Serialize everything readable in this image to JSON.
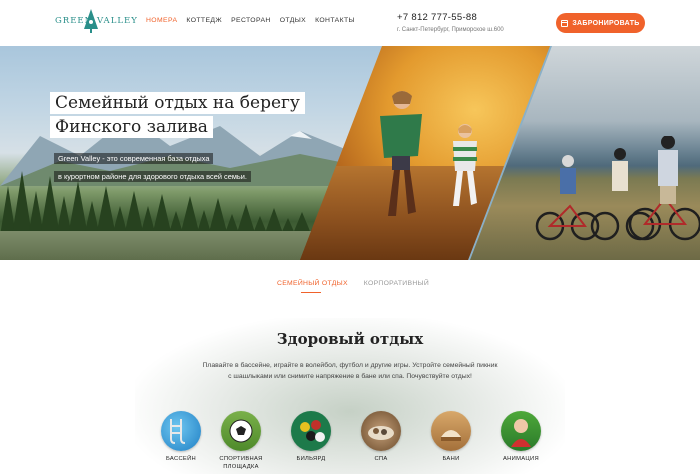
{
  "header": {
    "logo": {
      "word1": "GREEN",
      "word2": "VALLEY",
      "accent": "#2a8f8a"
    },
    "nav": [
      {
        "label": "НОМЕРА",
        "active": true
      },
      {
        "label": "КОТТЕДЖ",
        "active": false
      },
      {
        "label": "РЕСТОРАН",
        "active": false
      },
      {
        "label": "ОТДЫХ",
        "active": false
      },
      {
        "label": "КОНТАКТЫ",
        "active": false
      }
    ],
    "phone": "+7 812 777-55-88",
    "address": "г. Санкт-Петербург, Приморское ш.600",
    "book_button": {
      "label": "ЗАБРОНИРОВАТЬ",
      "icon": "calendar-icon",
      "color": "#f0622b"
    }
  },
  "hero": {
    "title_lines": [
      "Семейный отдых на  берегу",
      "Финского залива"
    ],
    "subtitle_lines": [
      "Green Valley - это современная база отдыха",
      "в курортном районе для здорового отдыха всей семьи."
    ]
  },
  "tabs": [
    {
      "label": "СЕМЕЙНЫЙ ОТДЫХ",
      "active": true
    },
    {
      "label": "КОРПОРАТИВНЫЙ",
      "active": false
    }
  ],
  "healthy": {
    "title": "Здоровый отдых",
    "description": "Плавайте в бассейне, играйте в волейбол, футбол и другие игры. Устройте семейный пикник с шашлыками или снимите напряжение в бане или спа. Почувствуйте отдых!",
    "features": [
      {
        "label": "БАССЕЙН",
        "icon": "pool-icon"
      },
      {
        "label": "СПОРТИВНАЯ ПЛОЩАДКА",
        "icon": "soccer-ball-icon"
      },
      {
        "label": "БИЛЬЯРД",
        "icon": "billiard-icon"
      },
      {
        "label": "СПА",
        "icon": "spa-icon"
      },
      {
        "label": "БАНИ",
        "icon": "sauna-icon"
      },
      {
        "label": "АНИМАЦИЯ",
        "icon": "animation-icon"
      }
    ]
  }
}
